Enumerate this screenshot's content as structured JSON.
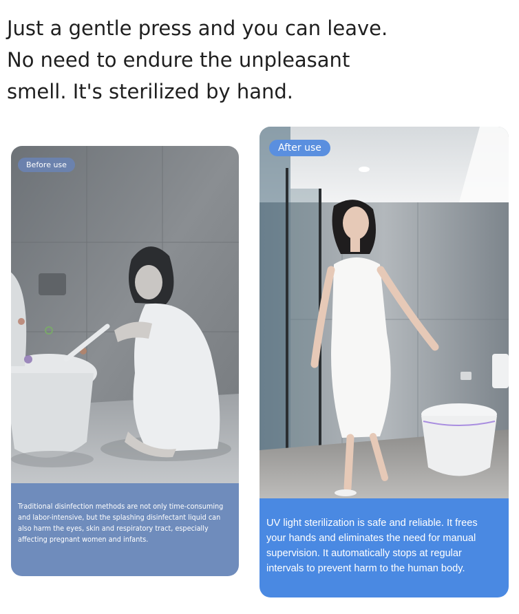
{
  "headline": {
    "line1": "Just a gentle press and you can leave.",
    "line2": "No need to endure the unpleasant",
    "line3": "smell. It's sterilized by hand."
  },
  "before_card": {
    "badge": "Before use",
    "caption": "Traditional disinfection methods are not only time-consuming and labor-intensive, but the splashing disinfectant liquid can also harm the eyes, skin and respiratory tract, especially affecting pregnant women and infants."
  },
  "after_card": {
    "badge": "After use",
    "caption": "UV light sterilization is safe and reliable. It frees your hands and eliminates the need for manual supervision. It automatically stops at regular intervals to prevent harm to the human body."
  },
  "colors": {
    "before_caption_bg": "#6f8cbc",
    "after_caption_bg": "#4a89e2",
    "after_badge_bg": "#5a8fdf"
  }
}
